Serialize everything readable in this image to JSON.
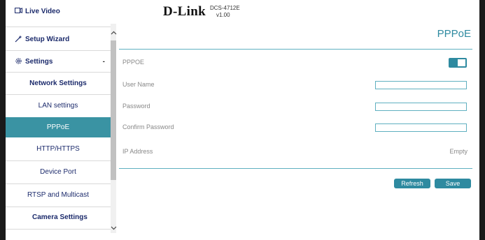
{
  "header": {
    "logo": "D-Link",
    "model": "DCS-4712E",
    "version": "v1.00"
  },
  "sidebar": {
    "items": [
      {
        "label": "Live Video",
        "icon": "video-icon"
      },
      {
        "label": "Setup Wizard",
        "icon": "wand-icon"
      },
      {
        "label": "Settings",
        "icon": "gear-icon",
        "expander": "-"
      },
      {
        "label": "Network Settings"
      },
      {
        "label": "LAN settings"
      },
      {
        "label": "PPPoE",
        "active": true
      },
      {
        "label": "HTTP/HTTPS"
      },
      {
        "label": "Device Port"
      },
      {
        "label": "RTSP and Multicast"
      },
      {
        "label": "Camera Settings"
      }
    ]
  },
  "main": {
    "title": "PPPoE",
    "rows": {
      "pppoe_label": "PPPOE",
      "pppoe_enabled": true,
      "username_label": "User Name",
      "username_value": "",
      "password_label": "Password",
      "password_value": "",
      "confirm_label": "Confirm Password",
      "confirm_value": "",
      "ip_label": "IP Address",
      "ip_value": "Empty"
    },
    "buttons": {
      "refresh": "Refresh",
      "save": "Save"
    }
  },
  "colors": {
    "accent": "#2e8aa0",
    "active_item": "#3a93a3",
    "nav_text": "#1b2a6b"
  }
}
